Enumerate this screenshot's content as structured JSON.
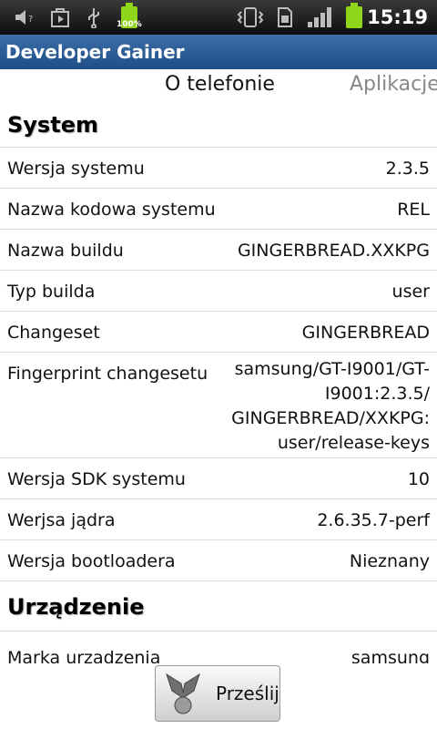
{
  "status_bar": {
    "battery_label": "100%",
    "time": "15:19",
    "icons": [
      "mute-icon",
      "play-store-icon",
      "usb-icon",
      "battery-icon",
      "vibrate-icon",
      "sim-icon",
      "signal-icon",
      "battery-icon"
    ]
  },
  "app": {
    "title": "Developer Gainer"
  },
  "tabs": {
    "active": "O telefonie",
    "inactive": "Aplikacje"
  },
  "sections": {
    "system": {
      "title": "System",
      "rows": [
        {
          "label": "Wersja systemu",
          "value": "2.3.5"
        },
        {
          "label": "Nazwa kodowa systemu",
          "value": "REL"
        },
        {
          "label": "Nazwa buildu",
          "value": "GINGERBREAD.XXKPG"
        },
        {
          "label": "Typ builda",
          "value": "user"
        },
        {
          "label": "Changeset",
          "value": "GINGERBREAD"
        },
        {
          "label": "Fingerprint changesetu",
          "value_lines": [
            "samsung/GT-I9001/GT-",
            "I9001:2.3.5/",
            "GINGERBREAD/XXKPG:",
            "user/release-keys"
          ]
        },
        {
          "label": "Wersja SDK systemu",
          "value": "10"
        },
        {
          "label": "Werjsa jądra",
          "value": "2.6.35.7-perf"
        },
        {
          "label": "Wersja bootloadera",
          "value": "Nieznany"
        }
      ]
    },
    "device": {
      "title": "Urządzenie",
      "rows": [
        {
          "label": "Marka urządzenia",
          "value": "samsung"
        }
      ]
    }
  },
  "bottom": {
    "send_label": "Prześlij"
  },
  "colors": {
    "title_bar": "#2a5d97",
    "battery": "#8fd61a",
    "status_bar": "#1a1a1a"
  }
}
